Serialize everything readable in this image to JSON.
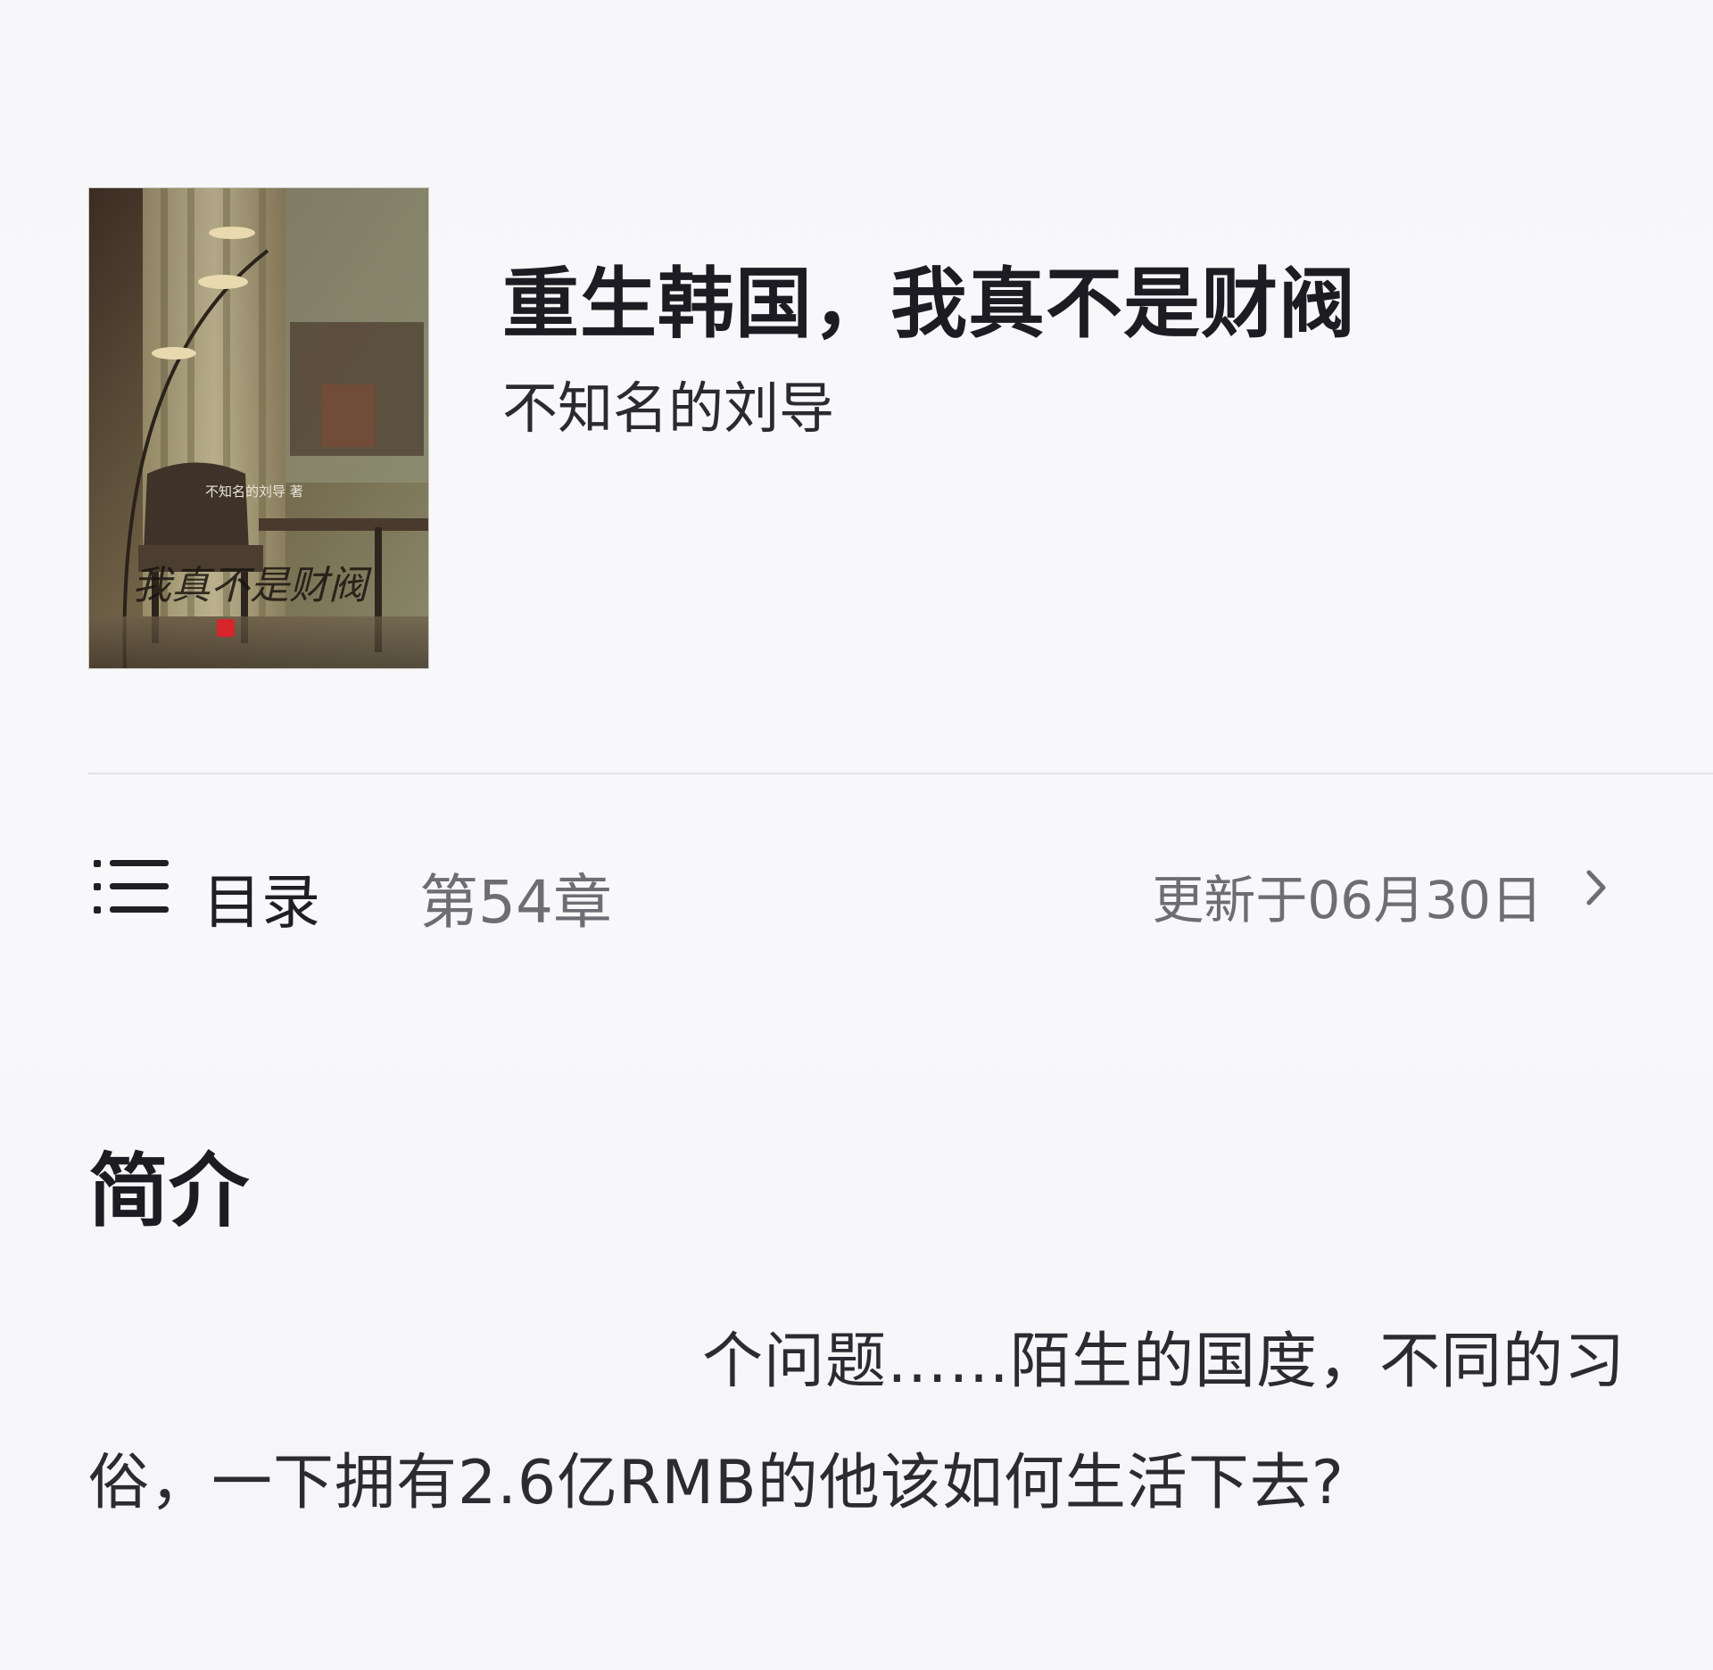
{
  "book": {
    "title": "重生韩国，我真不是财阀",
    "author": "不知名的刘导",
    "cover": {
      "author_text": "不知名的刘导 著",
      "title_text": "我真不是财阀",
      "description": "book-cover-image"
    }
  },
  "catalog": {
    "icon": "menu-list-icon",
    "label": "目录",
    "latest_chapter": "第54章",
    "update_text": "更新于06月30日",
    "arrow_icon": "chevron-right-icon"
  },
  "synopsis": {
    "heading": "简介",
    "line1": "个问题……陌生的国度，不同的习",
    "line2": "俗，一下拥有2.6亿RMB的他该如何生活下去?"
  }
}
